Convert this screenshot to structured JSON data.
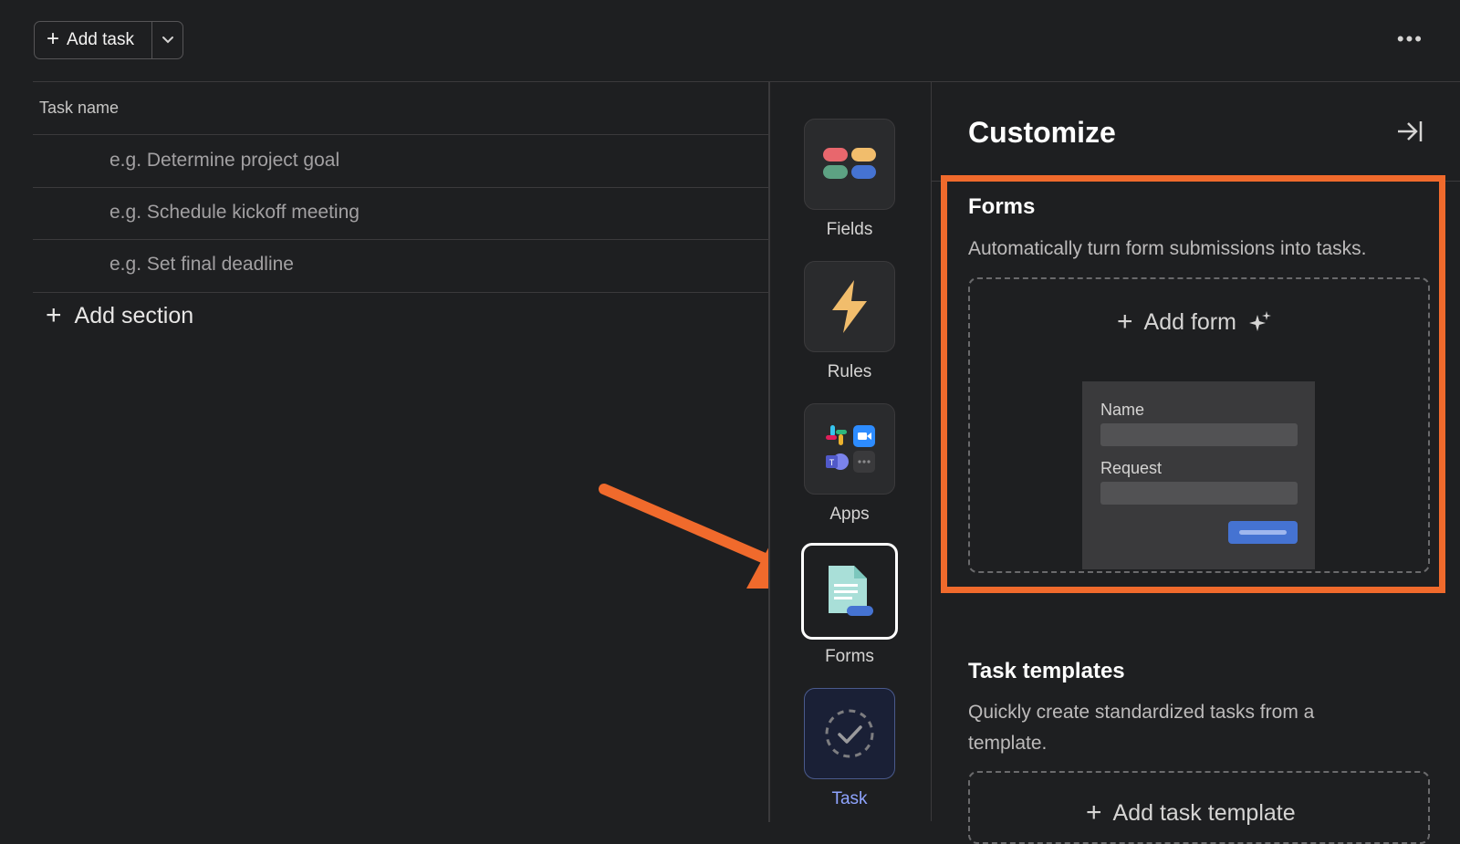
{
  "toolbar": {
    "add_task_label": "Add task",
    "plus_glyph": "+",
    "more_glyph": "•••"
  },
  "task_list": {
    "column_header": "Task name",
    "rows": [
      "e.g. Determine project goal",
      "e.g. Schedule kickoff meeting",
      "e.g. Set final deadline"
    ],
    "add_section_label": "Add section"
  },
  "customize": {
    "title": "Customize",
    "rail": [
      {
        "label": "Fields",
        "icon": "fields-icon"
      },
      {
        "label": "Rules",
        "icon": "lightning-icon"
      },
      {
        "label": "Apps",
        "icon": "apps-icon"
      },
      {
        "label": "Forms",
        "icon": "form-document-icon"
      },
      {
        "label": "Task",
        "icon": "task-template-check-icon"
      }
    ],
    "forms": {
      "title": "Forms",
      "description": "Automatically turn form submissions into tasks.",
      "add_label": "Add form",
      "preview_fields": [
        "Name",
        "Request"
      ]
    },
    "task_templates": {
      "title": "Task templates",
      "description": "Quickly create standardized tasks from a template.",
      "add_label": "Add task template"
    }
  },
  "colors": {
    "background": "#1e1f21",
    "highlight": "#f06a2c",
    "accent_blue": "#4573d2"
  }
}
